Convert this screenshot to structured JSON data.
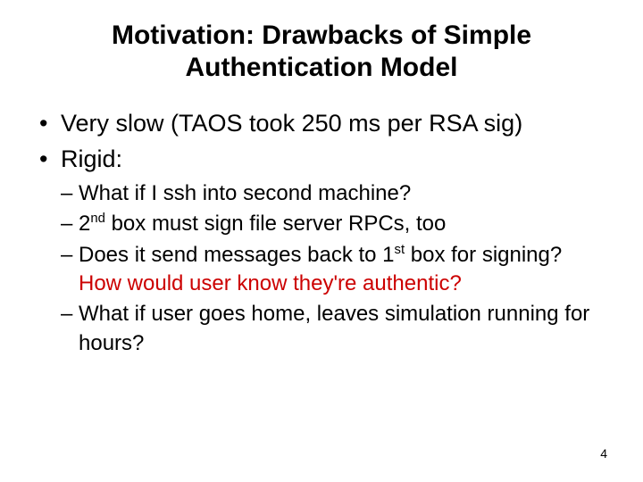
{
  "title": {
    "line1": "Motivation: Drawbacks of Simple",
    "line2": "Authentication Model"
  },
  "bullets": [
    {
      "text": "Very slow (TAOS took 250 ms per RSA sig)"
    },
    {
      "text": "Rigid:"
    }
  ],
  "sub": [
    {
      "parts": [
        {
          "t": "What if I ssh into second machine?"
        }
      ]
    },
    {
      "parts": [
        {
          "t": "2"
        },
        {
          "sup": "nd"
        },
        {
          "t": " box must sign file server RPCs, too"
        }
      ]
    },
    {
      "parts": [
        {
          "t": "Does it send messages back to 1"
        },
        {
          "sup": "st"
        },
        {
          "t": " box for signing? "
        },
        {
          "t": "How would user know they're authentic?",
          "red": true
        }
      ]
    },
    {
      "parts": [
        {
          "t": "What if user goes home, leaves simulation running for hours?"
        }
      ]
    }
  ],
  "pageNumber": "4"
}
